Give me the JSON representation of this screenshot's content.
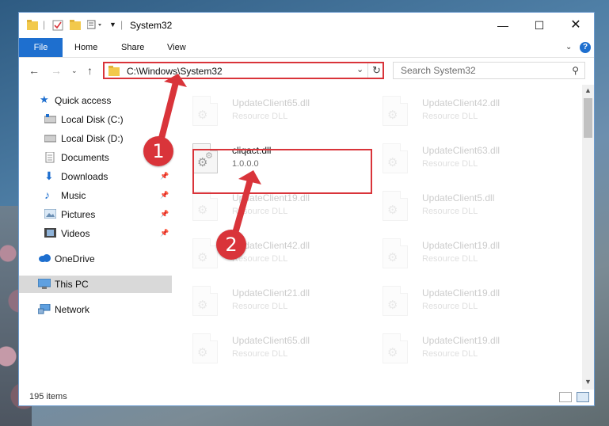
{
  "window": {
    "title": "System32"
  },
  "ribbon": {
    "tabs": [
      "File",
      "Home",
      "Share",
      "View"
    ]
  },
  "address": {
    "path": "C:\\Windows\\System32"
  },
  "search": {
    "placeholder": "Search System32"
  },
  "sidebar": {
    "quick_access": "Quick access",
    "items": [
      {
        "label": "Local Disk (C:)",
        "icon": "drive-icon",
        "pinned": false
      },
      {
        "label": "Local Disk (D:)",
        "icon": "drive-icon",
        "pinned": false
      },
      {
        "label": "Documents",
        "icon": "documents-icon",
        "pinned": true
      },
      {
        "label": "Downloads",
        "icon": "downloads-icon",
        "pinned": true
      },
      {
        "label": "Music",
        "icon": "music-icon",
        "pinned": true
      },
      {
        "label": "Pictures",
        "icon": "pictures-icon",
        "pinned": true
      },
      {
        "label": "Videos",
        "icon": "videos-icon",
        "pinned": true
      }
    ],
    "onedrive": "OneDrive",
    "this_pc": "This PC",
    "network": "Network"
  },
  "files": {
    "highlighted": {
      "name": "cliqact.dll",
      "version": "1.0.0.0"
    },
    "left_column": [
      {
        "name": "UpdateClient65.dll",
        "type": "Resource DLL"
      },
      {
        "name": "UpdateClient19.dll",
        "type": "Resource DLL"
      },
      {
        "name": "UpdateClient42.dll",
        "type": "Resource DLL"
      },
      {
        "name": "UpdateClient21.dll",
        "type": "Resource DLL"
      },
      {
        "name": "UpdateClient65.dll",
        "type": "Resource DLL"
      }
    ],
    "right_column": [
      {
        "name": "UpdateClient42.dll",
        "type": "Resource DLL"
      },
      {
        "name": "UpdateClient63.dll",
        "type": "Resource DLL"
      },
      {
        "name": "UpdateClient5.dll",
        "type": "Resource DLL"
      },
      {
        "name": "UpdateClient19.dll",
        "type": "Resource DLL"
      },
      {
        "name": "UpdateClient19.dll",
        "type": "Resource DLL"
      },
      {
        "name": "UpdateClient19.dll",
        "type": "Resource DLL"
      }
    ]
  },
  "status": {
    "item_count": "195 items"
  },
  "annotations": {
    "step1": "1",
    "step2": "2",
    "accent": "#d9343a"
  }
}
